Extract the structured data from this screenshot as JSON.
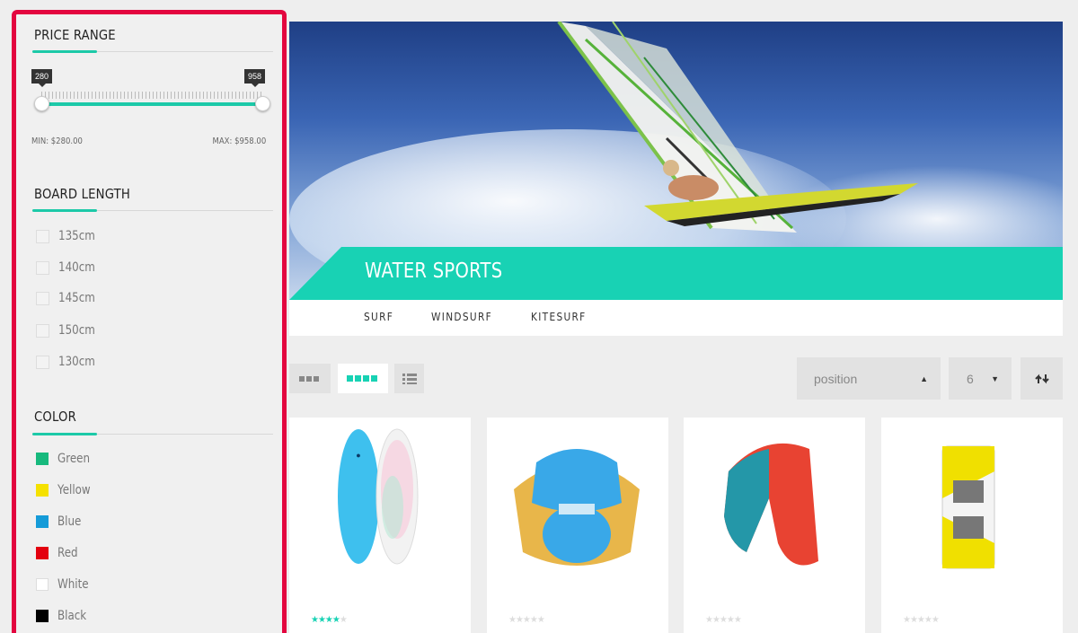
{
  "sidebar": {
    "price": {
      "title": "PRICE RANGE",
      "low_tag": "280",
      "high_tag": "958",
      "min_label": "MIN: $280.00",
      "max_label": "MAX: $958.00"
    },
    "length": {
      "title": "BOARD LENGTH",
      "options": [
        "135cm",
        "140cm",
        "145cm",
        "150cm",
        "130cm"
      ]
    },
    "color": {
      "title": "COLOR",
      "options": [
        {
          "label": "Green",
          "hex": "#17b97d"
        },
        {
          "label": "Yellow",
          "hex": "#f5e100"
        },
        {
          "label": "Blue",
          "hex": "#159bd8"
        },
        {
          "label": "Red",
          "hex": "#e3000f"
        },
        {
          "label": "White",
          "hex": "#ffffff"
        },
        {
          "label": "Black",
          "hex": "#000000"
        }
      ]
    },
    "accent": "#1cc9a8",
    "border_highlight": "#e3063f"
  },
  "hero": {
    "title": "WATER SPORTS",
    "banner_color": "#18d2b4"
  },
  "subnav": {
    "items": [
      "SURF",
      "WINDSURF",
      "KITESURF"
    ]
  },
  "toolbar": {
    "views": [
      "grid-3-icon",
      "grid-4-icon",
      "list-icon"
    ],
    "sort_value": "position",
    "limit_value": "6",
    "sort_direction_icon": "sort-direction-icon"
  },
  "products": [
    {
      "icon": "surfboard-icon",
      "rating": 4
    },
    {
      "icon": "harness-icon",
      "rating": 0
    },
    {
      "icon": "kite-icon",
      "rating": 0
    },
    {
      "icon": "kiteboard-icon",
      "rating": 0
    }
  ]
}
